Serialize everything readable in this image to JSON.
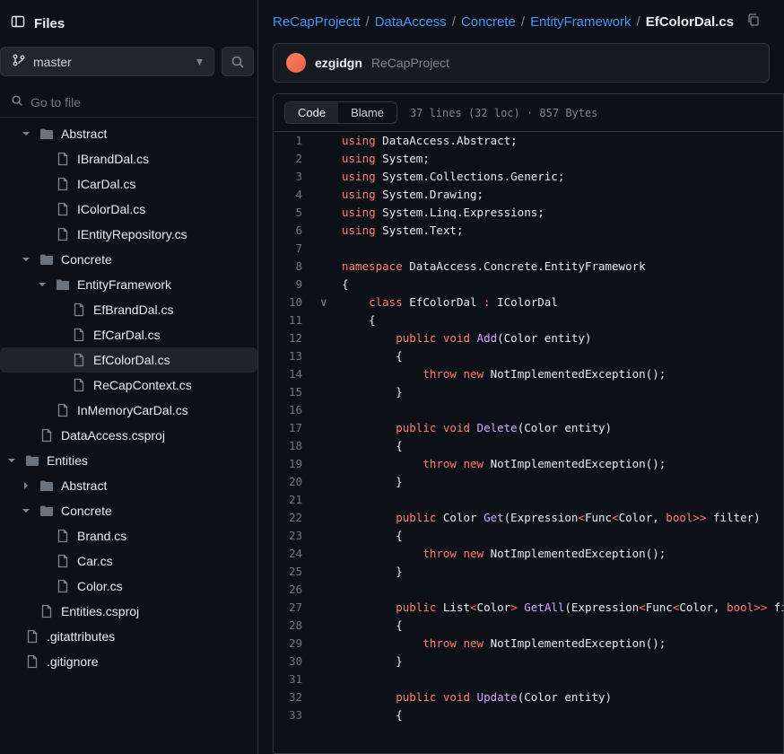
{
  "header": {
    "title": "Files"
  },
  "branch": {
    "name": "master"
  },
  "goto": {
    "placeholder": "Go to file"
  },
  "tree": [
    {
      "depth": 1,
      "type": "dir",
      "name": "Abstract",
      "open": true,
      "data_name": "folder-abstract"
    },
    {
      "depth": 2,
      "type": "file",
      "name": "IBrandDal.cs",
      "data_name": "file-ibranddal"
    },
    {
      "depth": 2,
      "type": "file",
      "name": "ICarDal.cs",
      "data_name": "file-icardal"
    },
    {
      "depth": 2,
      "type": "file",
      "name": "IColorDal.cs",
      "data_name": "file-icolordal"
    },
    {
      "depth": 2,
      "type": "file",
      "name": "IEntityRepository.cs",
      "data_name": "file-ientityrepository"
    },
    {
      "depth": 1,
      "type": "dir",
      "name": "Concrete",
      "open": true,
      "data_name": "folder-concrete"
    },
    {
      "depth": 2,
      "type": "dir",
      "name": "EntityFramework",
      "open": true,
      "data_name": "folder-entityframework"
    },
    {
      "depth": 3,
      "type": "file",
      "name": "EfBrandDal.cs",
      "data_name": "file-efbranddal"
    },
    {
      "depth": 3,
      "type": "file",
      "name": "EfCarDal.cs",
      "data_name": "file-efcardal"
    },
    {
      "depth": 3,
      "type": "file",
      "name": "EfColorDal.cs",
      "active": true,
      "data_name": "file-efcolordal"
    },
    {
      "depth": 3,
      "type": "file",
      "name": "ReCapContext.cs",
      "data_name": "file-recapcontext"
    },
    {
      "depth": 2,
      "type": "file",
      "name": "InMemoryCarDal.cs",
      "data_name": "file-inmemorycardal"
    },
    {
      "depth": 1,
      "type": "file",
      "name": "DataAccess.csproj",
      "data_name": "file-dataaccess-csproj"
    },
    {
      "depth": 0,
      "type": "dir",
      "name": "Entities",
      "open": true,
      "data_name": "folder-entities"
    },
    {
      "depth": 1,
      "type": "dir",
      "name": "Abstract",
      "open": false,
      "data_name": "folder-entities-abstract"
    },
    {
      "depth": 1,
      "type": "dir",
      "name": "Concrete",
      "open": true,
      "data_name": "folder-entities-concrete"
    },
    {
      "depth": 2,
      "type": "file",
      "name": "Brand.cs",
      "data_name": "file-brand"
    },
    {
      "depth": 2,
      "type": "file",
      "name": "Car.cs",
      "data_name": "file-car"
    },
    {
      "depth": 2,
      "type": "file",
      "name": "Color.cs",
      "data_name": "file-color"
    },
    {
      "depth": 1,
      "type": "file",
      "name": "Entities.csproj",
      "data_name": "file-entities-csproj"
    },
    {
      "depth": 0,
      "type": "file",
      "name": ".gitattributes",
      "data_name": "file-gitattributes"
    },
    {
      "depth": 0,
      "type": "file",
      "name": ".gitignore",
      "data_name": "file-gitignore"
    }
  ],
  "breadcrumb": {
    "parts": [
      {
        "text": "ReCapProjectt",
        "link": true
      },
      {
        "text": "DataAccess",
        "link": true
      },
      {
        "text": "Concrete",
        "link": true
      },
      {
        "text": "EntityFramework",
        "link": true
      },
      {
        "text": "EfColorDal.cs",
        "link": false
      }
    ]
  },
  "contrib": {
    "user": "ezgidgn",
    "repo": "ReCapProject"
  },
  "tabs": {
    "code": "Code",
    "blame": "Blame"
  },
  "meta": "37 lines (32 loc) · 857 Bytes",
  "code": [
    {
      "n": 1,
      "tokens": [
        [
          "k-red",
          "using"
        ],
        [
          "",
          " DataAccess.Abstract;"
        ]
      ]
    },
    {
      "n": 2,
      "tokens": [
        [
          "k-red",
          "using"
        ],
        [
          "",
          " System;"
        ]
      ]
    },
    {
      "n": 3,
      "tokens": [
        [
          "k-red",
          "using"
        ],
        [
          "",
          " System.Collections.Generic;"
        ]
      ]
    },
    {
      "n": 4,
      "tokens": [
        [
          "k-red",
          "using"
        ],
        [
          "",
          " System.Drawing;"
        ]
      ]
    },
    {
      "n": 5,
      "tokens": [
        [
          "k-red",
          "using"
        ],
        [
          "",
          " System.Linq.Expressions;"
        ]
      ]
    },
    {
      "n": 6,
      "tokens": [
        [
          "k-red",
          "using"
        ],
        [
          "",
          " System.Text;"
        ]
      ]
    },
    {
      "n": 7,
      "tokens": []
    },
    {
      "n": 8,
      "tokens": [
        [
          "k-red",
          "namespace"
        ],
        [
          "",
          " DataAccess.Concrete.EntityFramework"
        ]
      ]
    },
    {
      "n": 9,
      "tokens": [
        [
          "",
          "{"
        ]
      ]
    },
    {
      "n": 10,
      "gutter": "∨",
      "tokens": [
        [
          "",
          "    "
        ],
        [
          "k-red",
          "class"
        ],
        [
          "",
          " EfColorDal "
        ],
        [
          "k-red",
          ":"
        ],
        [
          "",
          " IColorDal"
        ]
      ]
    },
    {
      "n": 11,
      "tokens": [
        [
          "",
          "    {"
        ]
      ]
    },
    {
      "n": 12,
      "tokens": [
        [
          "",
          "        "
        ],
        [
          "k-red",
          "public"
        ],
        [
          "",
          " "
        ],
        [
          "k-red",
          "void"
        ],
        [
          "",
          " "
        ],
        [
          "k-purple",
          "Add"
        ],
        [
          "",
          "(Color entity)"
        ]
      ]
    },
    {
      "n": 13,
      "tokens": [
        [
          "",
          "        {"
        ]
      ]
    },
    {
      "n": 14,
      "tokens": [
        [
          "",
          "            "
        ],
        [
          "k-red",
          "throw"
        ],
        [
          "",
          " "
        ],
        [
          "k-red",
          "new"
        ],
        [
          "",
          " NotImplementedException();"
        ]
      ]
    },
    {
      "n": 15,
      "tokens": [
        [
          "",
          "        }"
        ]
      ]
    },
    {
      "n": 16,
      "tokens": []
    },
    {
      "n": 17,
      "tokens": [
        [
          "",
          "        "
        ],
        [
          "k-red",
          "public"
        ],
        [
          "",
          " "
        ],
        [
          "k-red",
          "void"
        ],
        [
          "",
          " "
        ],
        [
          "k-purple",
          "Delete"
        ],
        [
          "",
          "(Color entity)"
        ]
      ]
    },
    {
      "n": 18,
      "tokens": [
        [
          "",
          "        {"
        ]
      ]
    },
    {
      "n": 19,
      "tokens": [
        [
          "",
          "            "
        ],
        [
          "k-red",
          "throw"
        ],
        [
          "",
          " "
        ],
        [
          "k-red",
          "new"
        ],
        [
          "",
          " NotImplementedException();"
        ]
      ]
    },
    {
      "n": 20,
      "tokens": [
        [
          "",
          "        }"
        ]
      ]
    },
    {
      "n": 21,
      "tokens": []
    },
    {
      "n": 22,
      "tokens": [
        [
          "",
          "        "
        ],
        [
          "k-red",
          "public"
        ],
        [
          "",
          " Color "
        ],
        [
          "k-purple",
          "Get"
        ],
        [
          "",
          "(Expression"
        ],
        [
          "k-red",
          "<"
        ],
        [
          "",
          "Func"
        ],
        [
          "k-red",
          "<"
        ],
        [
          "",
          "Color, "
        ],
        [
          "k-red",
          "bool"
        ],
        [
          "k-red",
          ">>"
        ],
        [
          "",
          " filter)"
        ]
      ]
    },
    {
      "n": 23,
      "tokens": [
        [
          "",
          "        {"
        ]
      ]
    },
    {
      "n": 24,
      "tokens": [
        [
          "",
          "            "
        ],
        [
          "k-red",
          "throw"
        ],
        [
          "",
          " "
        ],
        [
          "k-red",
          "new"
        ],
        [
          "",
          " NotImplementedException();"
        ]
      ]
    },
    {
      "n": 25,
      "tokens": [
        [
          "",
          "        }"
        ]
      ]
    },
    {
      "n": 26,
      "tokens": []
    },
    {
      "n": 27,
      "tokens": [
        [
          "",
          "        "
        ],
        [
          "k-red",
          "public"
        ],
        [
          "",
          " List"
        ],
        [
          "k-red",
          "<"
        ],
        [
          "",
          "Color"
        ],
        [
          "k-red",
          ">"
        ],
        [
          "",
          " "
        ],
        [
          "k-purple",
          "GetAll"
        ],
        [
          "",
          "(Expression"
        ],
        [
          "k-red",
          "<"
        ],
        [
          "",
          "Func"
        ],
        [
          "k-red",
          "<"
        ],
        [
          "",
          "Color, "
        ],
        [
          "k-red",
          "bool"
        ],
        [
          "k-red",
          ">>"
        ],
        [
          "",
          " fi"
        ]
      ]
    },
    {
      "n": 28,
      "tokens": [
        [
          "",
          "        {"
        ]
      ]
    },
    {
      "n": 29,
      "tokens": [
        [
          "",
          "            "
        ],
        [
          "k-red",
          "throw"
        ],
        [
          "",
          " "
        ],
        [
          "k-red",
          "new"
        ],
        [
          "",
          " NotImplementedException();"
        ]
      ]
    },
    {
      "n": 30,
      "tokens": [
        [
          "",
          "        }"
        ]
      ]
    },
    {
      "n": 31,
      "tokens": []
    },
    {
      "n": 32,
      "tokens": [
        [
          "",
          "        "
        ],
        [
          "k-red",
          "public"
        ],
        [
          "",
          " "
        ],
        [
          "k-red",
          "void"
        ],
        [
          "",
          " "
        ],
        [
          "k-purple",
          "Update"
        ],
        [
          "",
          "(Color entity)"
        ]
      ]
    },
    {
      "n": 33,
      "tokens": [
        [
          "",
          "        {"
        ]
      ]
    }
  ]
}
